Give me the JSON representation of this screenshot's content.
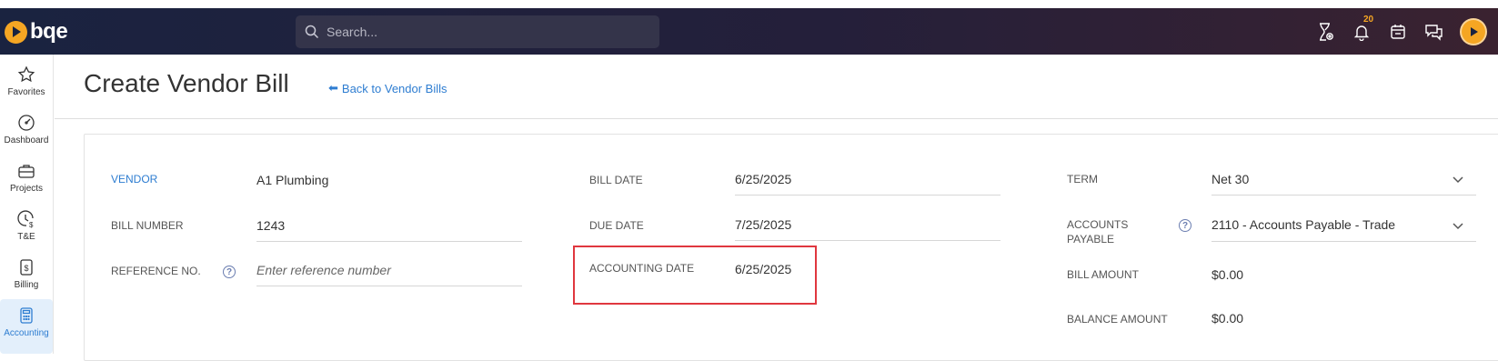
{
  "app": {
    "logo_text": "bqe"
  },
  "search": {
    "placeholder": "Search..."
  },
  "topbar": {
    "notifications_count": "20"
  },
  "sidebar": {
    "items": [
      {
        "label": "Favorites"
      },
      {
        "label": "Dashboard"
      },
      {
        "label": "Projects"
      },
      {
        "label": "T&E"
      },
      {
        "label": "Billing"
      },
      {
        "label": "Accounting"
      }
    ]
  },
  "header": {
    "title": "Create Vendor Bill",
    "back_link": "Back to Vendor Bills"
  },
  "form": {
    "vendor": {
      "label": "VENDOR",
      "value": "A1 Plumbing"
    },
    "bill_number": {
      "label": "BILL NUMBER",
      "value": "1243"
    },
    "reference_no": {
      "label": "REFERENCE NO.",
      "placeholder": "Enter reference number"
    },
    "bill_date": {
      "label": "BILL DATE",
      "value": "6/25/2025"
    },
    "due_date": {
      "label": "DUE DATE",
      "value": "7/25/2025"
    },
    "accounting_date": {
      "label": "ACCOUNTING DATE",
      "value": "6/25/2025"
    },
    "term": {
      "label": "TERM",
      "value": "Net 30"
    },
    "accounts_payable": {
      "label_line1": "ACCOUNTS",
      "label_line2": "PAYABLE",
      "value": "2110 - Accounts Payable - Trade"
    },
    "bill_amount": {
      "label": "BILL AMOUNT",
      "value": "$0.00"
    },
    "balance_amount": {
      "label": "BALANCE AMOUNT",
      "value": "$0.00"
    }
  },
  "colors": {
    "accent": "#2e7dd1",
    "brand": "#f5a623",
    "highlight": "#e0373f"
  }
}
